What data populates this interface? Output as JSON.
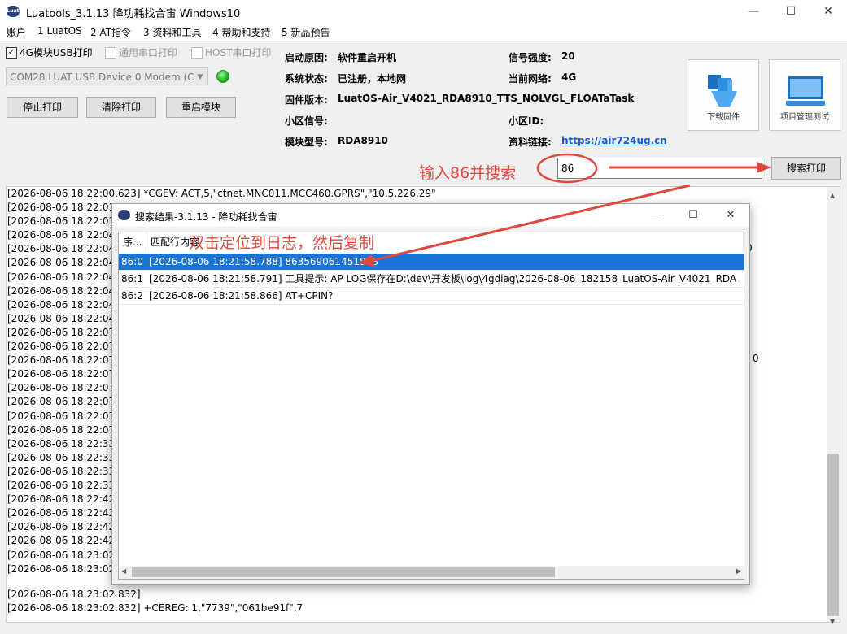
{
  "window": {
    "title": "Luatools_3.1.13 降功耗找合宙 Windows10",
    "logo_text": "Luat"
  },
  "menu": [
    "账户",
    "1 LuatOS",
    "2 AT指令",
    "3 资料和工具",
    "4 帮助和支持",
    "5 新品预告"
  ],
  "options": {
    "usb_print": "4G模块USB打印",
    "serial_print": "通用串口打印",
    "host_print": "HOST串口打印",
    "port": "COM28 LUAT USB Device 0 Modem (C"
  },
  "buttons": {
    "stop": "停止打印",
    "clear": "清除打印",
    "restart": "重启模块",
    "search": "搜索打印"
  },
  "info": {
    "boot_reason_label": "启动原因:",
    "boot_reason": "软件重启开机",
    "system_status_label": "系统状态:",
    "system_status": "已注册，本地网",
    "firmware_label": "固件版本:",
    "firmware": "LuatOS-Air_V4021_RDA8910_TTS_NOLVGL_FLOATaTask",
    "cell_signal_label": "小区信号:",
    "module_label": "模块型号:",
    "module": "RDA8910",
    "signal_label": "信号强度:",
    "signal": "20",
    "network_label": "当前网络:",
    "network": "4G",
    "cell_id_label": "小区ID:",
    "link_label": "资料链接:",
    "link": "https://air724ug.cn"
  },
  "tools": {
    "download": "下载固件",
    "project": "项目管理测试"
  },
  "search": {
    "value": "86"
  },
  "annotations": {
    "search_hint": "输入86并搜索",
    "dblclick_hint": "双击定位到日志，然后复制"
  },
  "log": {
    "first_line": "[2026-08-06 18:22:00.623] *CGEV: ACT,5,\"ctnet.MNC011.MCC460.GPRS\",\"10.5.226.29\"",
    "truncated": [
      "[2026-08-06 18:22:01.",
      "[2026-08-06 18:22:01.",
      "[2026-08-06 18:22:04.",
      "[2026-08-06 18:22:04.",
      "[2026-08-06 18:22:04.",
      "[2026-08-06 18:22:04.",
      "[2026-08-06 18:22:04.",
      "[2026-08-06 18:22:04.",
      "[2026-08-06 18:22:04.",
      "[2026-08-06 18:22:07.",
      "[2026-08-06 18:22:07.",
      "[2026-08-06 18:22:07.",
      "[2026-08-06 18:22:07.",
      "[2026-08-06 18:22:07.",
      "[2026-08-06 18:22:07.",
      "[2026-08-06 18:22:07.",
      "[2026-08-06 18:22:07.",
      "[2026-08-06 18:22:33.",
      "[2026-08-06 18:22:33.",
      "[2026-08-06 18:22:33.",
      "[2026-08-06 18:22:33.",
      "[2026-08-06 18:22:42.",
      "[2026-08-06 18:22:42.",
      "[2026-08-06 18:22:42.",
      "[2026-08-06 18:22:42.",
      "[2026-08-06 18:23:02.",
      "[2026-08-06 18:23:02."
    ],
    "line_second_last": "[2026-08-06 18:23:02.832]",
    "line_last": "[2026-08-06 18:23:02.832] +CEREG: 1,\"7739\",\"061be91f\",7",
    "tail_a": "0",
    "tail_b": "0"
  },
  "dialog": {
    "title": "搜索结果-3.1.13 - 降功耗找合宙",
    "col_index": "序...",
    "col_content": "匹配行内容",
    "rows": [
      {
        "index": "86:0",
        "content": "[2026-08-06 18:21:58.788] 863569061451878"
      },
      {
        "index": "86:1",
        "content": "[2026-08-06 18:21:58.791] 工具提示: AP LOG保存在D:\\dev\\开发板\\log\\4gdiag\\2026-08-06_182158_LuatOS-Air_V4021_RDA"
      },
      {
        "index": "86:2",
        "content": "[2026-08-06 18:21:58.866] AT+CPIN?"
      }
    ]
  },
  "colors": {
    "annotation": "#e0483e",
    "selection": "#1a74d4",
    "link": "#1a5ec5",
    "status_led": "#14b514"
  }
}
